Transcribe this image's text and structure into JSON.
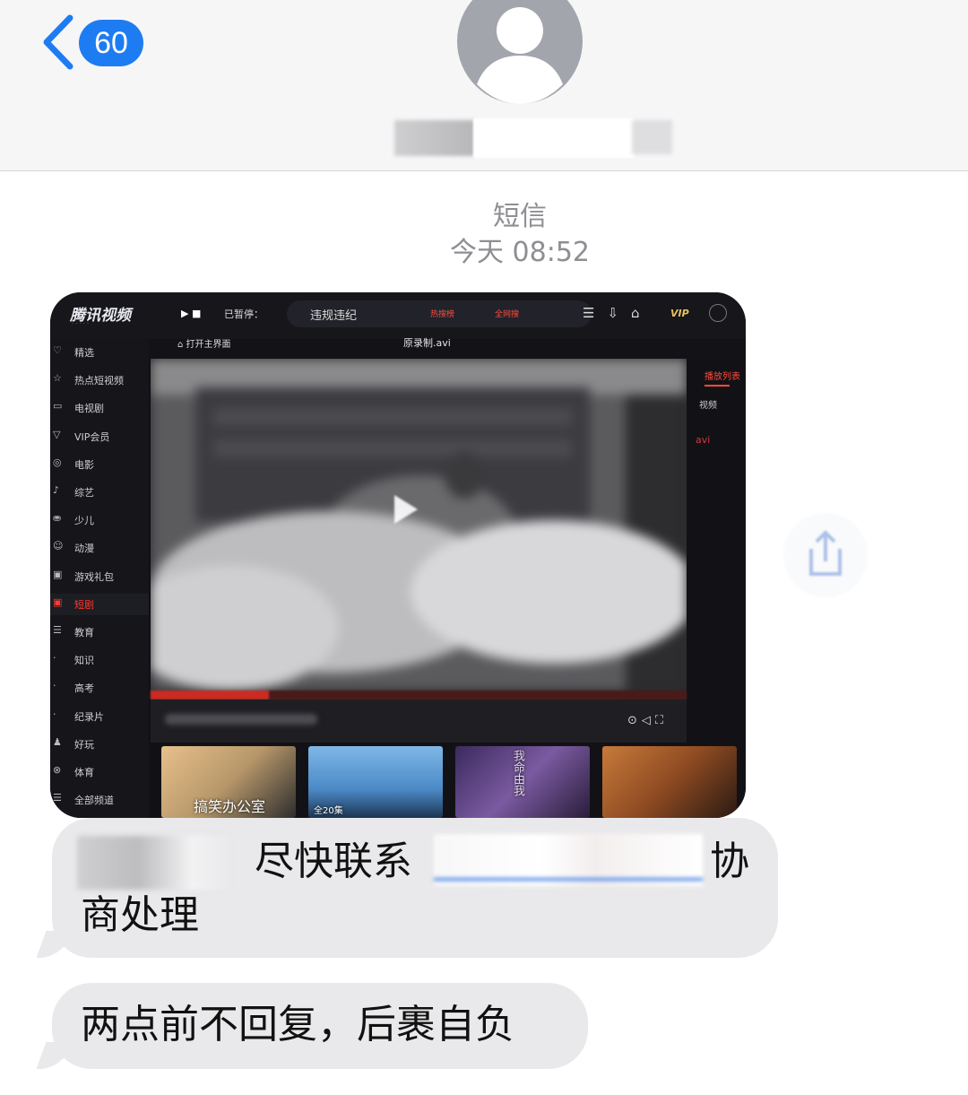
{
  "header": {
    "back_count": "60",
    "icons": {
      "back": "chevron-left-icon",
      "avatar": "person-icon"
    }
  },
  "meta": {
    "type": "短信",
    "time": "今天 08:52"
  },
  "screenshot": {
    "app_logo": "腾讯视频",
    "paused_label": "已暂停：",
    "search_query": "违规违纪",
    "hot_label": "热搜榜",
    "all_label": "全网搜",
    "vip_label": "VIP",
    "home_label": "打开主界面",
    "file_name": "原录制.avi",
    "sidebar": [
      {
        "label": "精选"
      },
      {
        "label": "热点短视频"
      },
      {
        "label": "电视剧"
      },
      {
        "label": "VIP会员"
      },
      {
        "label": "电影"
      },
      {
        "label": "综艺"
      },
      {
        "label": "少儿"
      },
      {
        "label": "动漫"
      },
      {
        "label": "游戏礼包"
      },
      {
        "label": "短剧"
      },
      {
        "label": "教育"
      },
      {
        "label": "知识"
      },
      {
        "label": "高考"
      },
      {
        "label": "纪录片"
      },
      {
        "label": "好玩"
      },
      {
        "label": "体育"
      },
      {
        "label": "全部频道"
      }
    ],
    "active_sidebar": "短剧",
    "right_panel": {
      "tab": "播放列表",
      "item": "视频",
      "file_ext": "avi"
    },
    "thumbnails": [
      {
        "caption": "搞笑办公室"
      },
      {
        "caption": "全20集"
      },
      {
        "caption": "我命由我"
      },
      {
        "caption": ""
      }
    ],
    "playback_progress": 0.22
  },
  "messages": [
    {
      "parts": [
        "尽快联系",
        "协",
        "商处理"
      ]
    },
    {
      "text": "两点前不回复，后裹自负"
    }
  ],
  "colors": {
    "accent": "#1e7cf2",
    "bubble": "#e9e9eb",
    "meta_text": "#8e8e93",
    "player_red": "#ff3b30"
  }
}
